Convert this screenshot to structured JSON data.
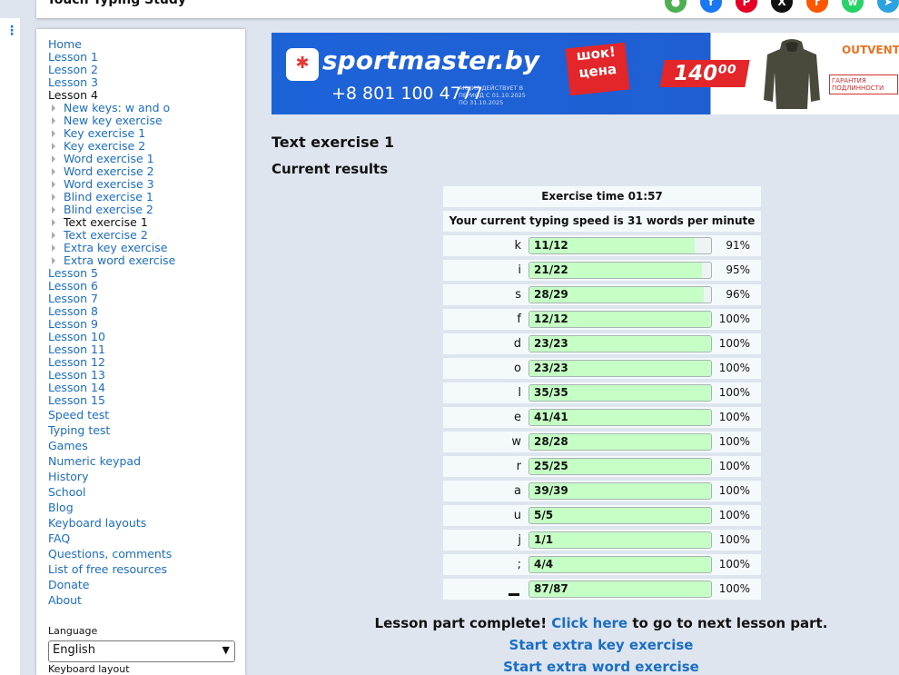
{
  "site": {
    "title": "Touch Typing Study"
  },
  "share_icons": [
    {
      "name": "frog-icon",
      "color": "#4caf50",
      "glyph": "●"
    },
    {
      "name": "facebook-icon",
      "color": "#1877f2",
      "glyph": "f"
    },
    {
      "name": "pinterest-icon",
      "color": "#e60023",
      "glyph": "P"
    },
    {
      "name": "x-icon",
      "color": "#111111",
      "glyph": "X"
    },
    {
      "name": "reddit-icon",
      "color": "#ff5700",
      "glyph": "r"
    },
    {
      "name": "whatsapp-icon",
      "color": "#25d366",
      "glyph": "w"
    },
    {
      "name": "telegram-icon",
      "color": "#2aa3df",
      "glyph": "➤"
    }
  ],
  "sidebar": {
    "nav": [
      {
        "label": "Home",
        "type": "lnk"
      },
      {
        "label": "Lesson 1",
        "type": "lnk"
      },
      {
        "label": "Lesson 2",
        "type": "lnk"
      },
      {
        "label": "Lesson 3",
        "type": "lnk"
      },
      {
        "label": "Lesson 4",
        "type": "cur"
      },
      {
        "label": "New keys: w and o",
        "type": "lnk sub"
      },
      {
        "label": "New key exercise",
        "type": "lnk sub"
      },
      {
        "label": "Key exercise 1",
        "type": "lnk sub"
      },
      {
        "label": "Key exercise 2",
        "type": "lnk sub"
      },
      {
        "label": "Word exercise 1",
        "type": "lnk sub"
      },
      {
        "label": "Word exercise 2",
        "type": "lnk sub"
      },
      {
        "label": "Word exercise 3",
        "type": "lnk sub"
      },
      {
        "label": "Blind exercise 1",
        "type": "lnk sub"
      },
      {
        "label": "Blind exercise 2",
        "type": "lnk sub"
      },
      {
        "label": "Text exercise 1",
        "type": "cur sub"
      },
      {
        "label": "Text exercise 2",
        "type": "lnk sub"
      },
      {
        "label": "Extra key exercise",
        "type": "lnk sub"
      },
      {
        "label": "Extra word exercise",
        "type": "lnk sub"
      },
      {
        "label": "Lesson 5",
        "type": "lnk"
      },
      {
        "label": "Lesson 6",
        "type": "lnk"
      },
      {
        "label": "Lesson 7",
        "type": "lnk"
      },
      {
        "label": "Lesson 8",
        "type": "lnk"
      },
      {
        "label": "Lesson 9",
        "type": "lnk"
      },
      {
        "label": "Lesson 10",
        "type": "lnk"
      },
      {
        "label": "Lesson 11",
        "type": "lnk"
      },
      {
        "label": "Lesson 12",
        "type": "lnk"
      },
      {
        "label": "Lesson 13",
        "type": "lnk"
      },
      {
        "label": "Lesson 14",
        "type": "lnk"
      },
      {
        "label": "Lesson 15",
        "type": "lnk"
      },
      {
        "label": "Speed test",
        "type": "lnk big"
      },
      {
        "label": "Typing test",
        "type": "lnk big"
      },
      {
        "label": "Games",
        "type": "lnk big"
      },
      {
        "label": "Numeric keypad",
        "type": "lnk big"
      },
      {
        "label": "History",
        "type": "lnk big"
      },
      {
        "label": "School",
        "type": "lnk big"
      },
      {
        "label": "Blog",
        "type": "lnk big"
      },
      {
        "label": "Keyboard layouts",
        "type": "lnk big"
      },
      {
        "label": "FAQ",
        "type": "lnk big"
      },
      {
        "label": "Questions, comments",
        "type": "lnk big"
      },
      {
        "label": "List of free resources",
        "type": "lnk big"
      },
      {
        "label": "Donate",
        "type": "lnk big"
      },
      {
        "label": "About",
        "type": "lnk big"
      }
    ],
    "language_label": "Language",
    "language_value": "English",
    "keyboard_layout_label": "Keyboard layout"
  },
  "ad": {
    "brand": "sportmaster.by",
    "phone": "+8 801 100 4777",
    "promo": "АКЦИЯ ДЕЙСТВУЕТ В ПЕРИОД С 01.10.2025 ПО 31.10.2025",
    "shock": "шок! цена",
    "price": "140⁰⁰",
    "side_brand": "OUTVENTURE",
    "guarantee": "ГАРАНТИЯ ПОДЛИННОСТИ"
  },
  "main": {
    "title": "Text exercise 1",
    "subtitle": "Current results",
    "exercise_time": "Exercise time 01:57",
    "speed_text": "Your current typing speed is 31 words per minute",
    "keys": [
      {
        "key": "k",
        "count": "11/12",
        "pct": "91%",
        "fraction": 0.91
      },
      {
        "key": "i",
        "count": "21/22",
        "pct": "95%",
        "fraction": 0.95
      },
      {
        "key": "s",
        "count": "28/29",
        "pct": "96%",
        "fraction": 0.96
      },
      {
        "key": "f",
        "count": "12/12",
        "pct": "100%",
        "fraction": 1.0
      },
      {
        "key": "d",
        "count": "23/23",
        "pct": "100%",
        "fraction": 1.0
      },
      {
        "key": "o",
        "count": "23/23",
        "pct": "100%",
        "fraction": 1.0
      },
      {
        "key": "l",
        "count": "35/35",
        "pct": "100%",
        "fraction": 1.0
      },
      {
        "key": "e",
        "count": "41/41",
        "pct": "100%",
        "fraction": 1.0
      },
      {
        "key": "w",
        "count": "28/28",
        "pct": "100%",
        "fraction": 1.0
      },
      {
        "key": "r",
        "count": "25/25",
        "pct": "100%",
        "fraction": 1.0
      },
      {
        "key": "a",
        "count": "39/39",
        "pct": "100%",
        "fraction": 1.0
      },
      {
        "key": "u",
        "count": "5/5",
        "pct": "100%",
        "fraction": 1.0
      },
      {
        "key": "j",
        "count": "1/1",
        "pct": "100%",
        "fraction": 1.0
      },
      {
        "key": ";",
        "count": "4/4",
        "pct": "100%",
        "fraction": 1.0
      },
      {
        "key": "space",
        "count": "87/87",
        "pct": "100%",
        "fraction": 1.0
      }
    ],
    "complete_text": "Lesson part complete!",
    "click_here": "Click here",
    "complete_tail": "to go to next lesson part.",
    "extra_key": "Start extra key exercise",
    "extra_word": "Start extra word exercise"
  },
  "colors": {
    "link": "#1a6fc4",
    "bar_fill": "#c6ffc6",
    "page_bg": "#dfe5ef"
  }
}
